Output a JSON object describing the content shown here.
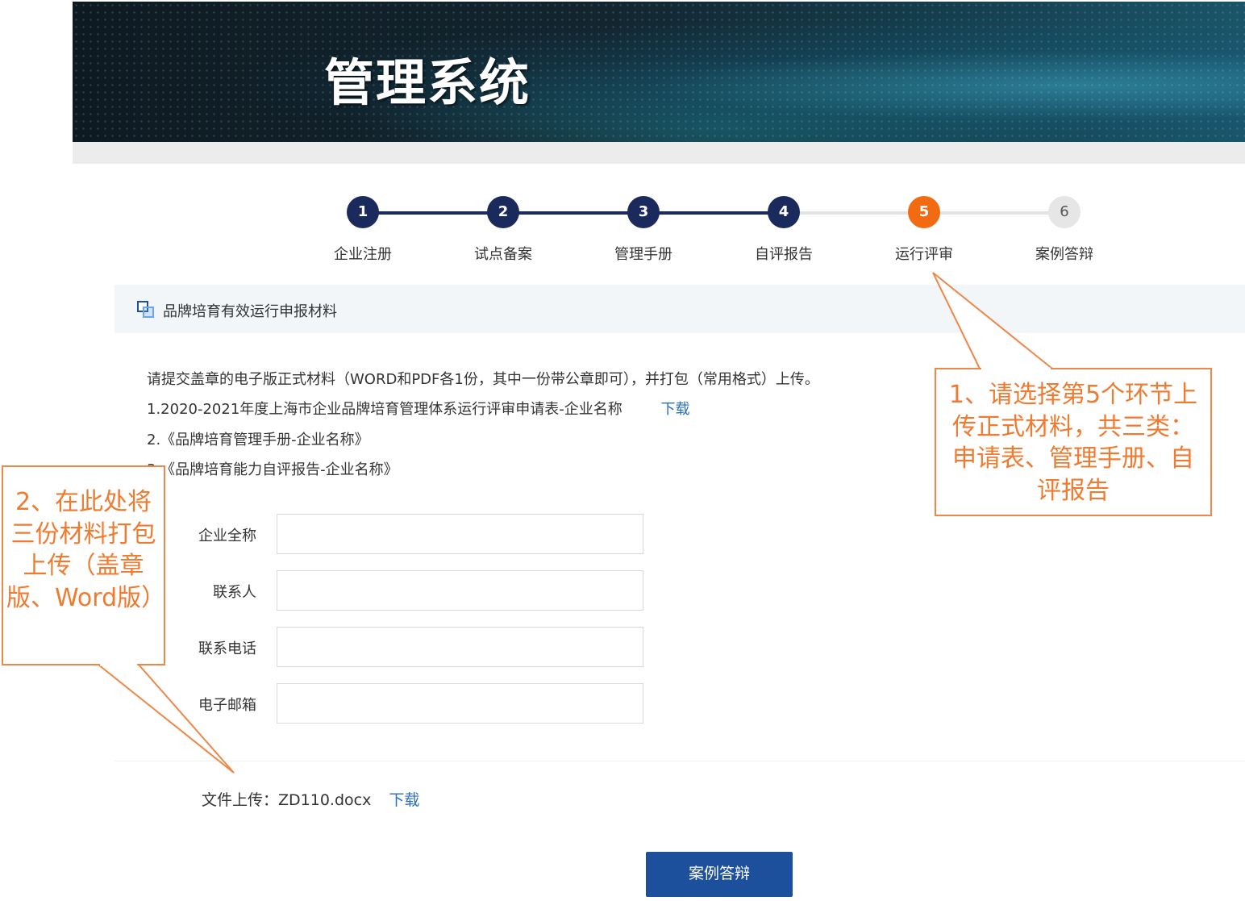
{
  "header": {
    "title": "管理系统"
  },
  "steps": [
    {
      "num": "1",
      "label": "企业注册"
    },
    {
      "num": "2",
      "label": "试点备案"
    },
    {
      "num": "3",
      "label": "管理手册"
    },
    {
      "num": "4",
      "label": "自评报告"
    },
    {
      "num": "5",
      "label": "运行评审"
    },
    {
      "num": "6",
      "label": "案例答辩"
    }
  ],
  "colors": {
    "done": "#1a2a5c",
    "active": "#f26b12",
    "pending": "#e6e6e6",
    "accent": "#1c4f9c",
    "callout": "#ee8748"
  },
  "section": {
    "title": "品牌培育有效运行申报材料"
  },
  "instructions": {
    "intro": "请提交盖章的电子版正式材料（WORD和PDF各1份，其中一份带公章即可），并打包（常用格式）上传。",
    "item1": "1.2020-2021年度上海市企业品牌培育管理体系运行评审申请表-企业名称",
    "item1_link": "下载",
    "item2": "2.《品牌培育管理手册-企业名称》",
    "item3": "3.《品牌培育能力自评报告-企业名称》"
  },
  "form": {
    "company": {
      "label": "企业全称",
      "value": ""
    },
    "contact": {
      "label": "联系人",
      "value": ""
    },
    "phone": {
      "label": "联系电话",
      "value": ""
    },
    "email": {
      "label": "电子邮箱",
      "value": ""
    }
  },
  "upload": {
    "label": "文件上传：",
    "filename": "ZD110.docx",
    "link": "下载"
  },
  "submit_label": "案例答辩",
  "callouts": {
    "c1": "1、请选择第5个环节上传正式材料，共三类：申请表、管理手册、自评报告",
    "c2": "2、在此处将三份材料打包上传（盖章版、Word版）"
  }
}
